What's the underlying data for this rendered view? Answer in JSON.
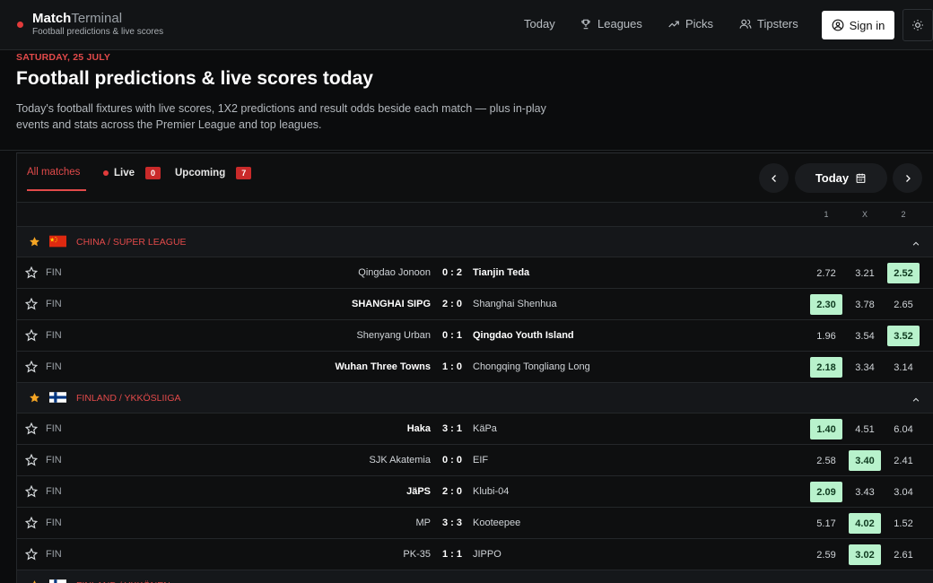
{
  "brand": {
    "name_bold": "Match",
    "name_light": "Terminal",
    "subtitle": "Football predictions & live scores"
  },
  "nav": [
    {
      "label": "Today",
      "icon": "none"
    },
    {
      "label": "Leagues",
      "icon": "trophy-icon"
    },
    {
      "label": "Picks",
      "icon": "trending-up-icon"
    },
    {
      "label": "Tipsters",
      "icon": "users-icon"
    }
  ],
  "signin": {
    "label": "Sign in"
  },
  "hero": {
    "date": "SATURDAY, 25 JULY",
    "title": "Football predictions & live scores today",
    "description": "Today's football fixtures with live scores, 1X2 predictions and result odds beside each match — plus in-play events and stats across the Premier League and top leagues."
  },
  "tabs": {
    "all": "All matches",
    "live": "Live",
    "live_count": "0",
    "upcoming": "Upcoming",
    "upcoming_count": "7"
  },
  "date_picker": {
    "label": "Today"
  },
  "odds_headers": [
    "1",
    "X",
    "2"
  ],
  "colors": {
    "accent": "#e24a4a",
    "odds_highlight": "#b8f2cc",
    "background": "#0b0c0d"
  },
  "leagues": [
    {
      "name": "CHINA / SUPER LEAGUE",
      "flag": "china",
      "matches": [
        {
          "status": "FIN",
          "home": "Qingdao Jonoon",
          "score": "0 : 2",
          "away": "Tianjin Teda",
          "winner": "away",
          "odds": [
            "2.72",
            "3.21",
            "2.52"
          ],
          "pick": 2
        },
        {
          "status": "FIN",
          "home": "SHANGHAI SIPG",
          "score": "2 : 0",
          "away": "Shanghai Shenhua",
          "winner": "home",
          "odds": [
            "2.30",
            "3.78",
            "2.65"
          ],
          "pick": 0
        },
        {
          "status": "FIN",
          "home": "Shenyang Urban",
          "score": "0 : 1",
          "away": "Qingdao Youth Island",
          "winner": "away",
          "odds": [
            "1.96",
            "3.54",
            "3.52"
          ],
          "pick": 2
        },
        {
          "status": "FIN",
          "home": "Wuhan Three Towns",
          "score": "1 : 0",
          "away": "Chongqing Tongliang Long",
          "winner": "home",
          "odds": [
            "2.18",
            "3.34",
            "3.14"
          ],
          "pick": 0
        }
      ]
    },
    {
      "name": "FINLAND / YKKÖSLIIGA",
      "flag": "finland",
      "matches": [
        {
          "status": "FIN",
          "home": "Haka",
          "score": "3 : 1",
          "away": "KäPa",
          "winner": "home",
          "odds": [
            "1.40",
            "4.51",
            "6.04"
          ],
          "pick": 0
        },
        {
          "status": "FIN",
          "home": "SJK Akatemia",
          "score": "0 : 0",
          "away": "EIF",
          "winner": "none",
          "odds": [
            "2.58",
            "3.40",
            "2.41"
          ],
          "pick": 1
        },
        {
          "status": "FIN",
          "home": "JäPS",
          "score": "2 : 0",
          "away": "Klubi-04",
          "winner": "home",
          "odds": [
            "2.09",
            "3.43",
            "3.04"
          ],
          "pick": 0
        },
        {
          "status": "FIN",
          "home": "MP",
          "score": "3 : 3",
          "away": "Kooteepee",
          "winner": "none",
          "odds": [
            "5.17",
            "4.02",
            "1.52"
          ],
          "pick": 1
        },
        {
          "status": "FIN",
          "home": "PK-35",
          "score": "1 : 1",
          "away": "JIPPO",
          "winner": "none",
          "odds": [
            "2.59",
            "3.02",
            "2.61"
          ],
          "pick": 1
        }
      ]
    },
    {
      "name": "FINLAND / YKKÖNEN",
      "flag": "finland",
      "matches": []
    }
  ]
}
